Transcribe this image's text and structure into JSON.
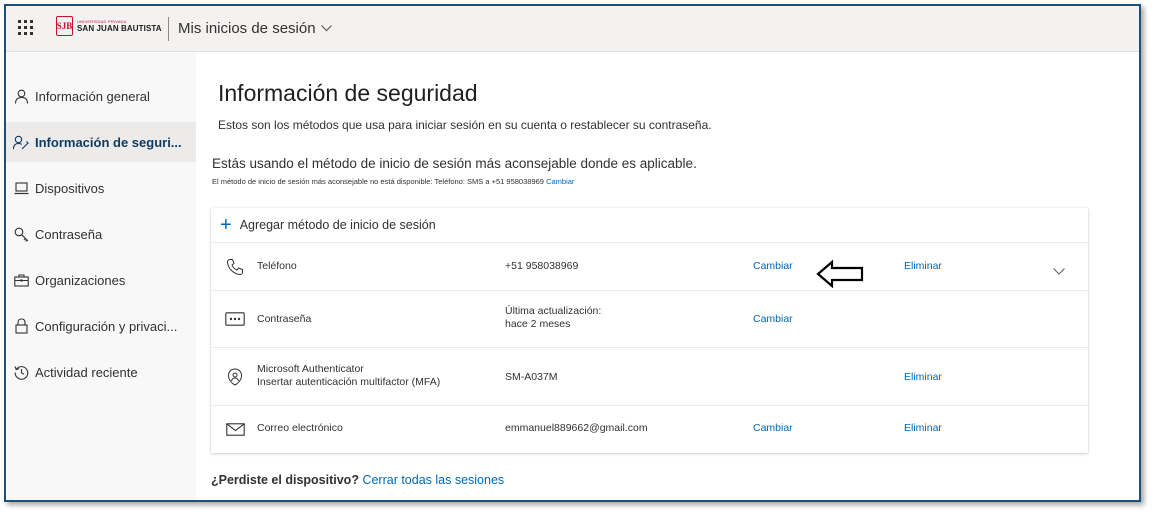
{
  "header": {
    "logo_small": "UNIVERSIDAD PRIVADA",
    "logo_name": "SAN JUAN BAUTISTA",
    "logo_initials": "SJB",
    "title": "Mis inicios de sesión",
    "icons": [
      "waffle-icon",
      "chevron-down-icon"
    ]
  },
  "sidebar": {
    "items": [
      {
        "label": "Información general",
        "icon": "person-icon"
      },
      {
        "label": "Información de seguri...",
        "icon": "security-info-icon"
      },
      {
        "label": "Dispositivos",
        "icon": "laptop-icon"
      },
      {
        "label": "Contraseña",
        "icon": "key-icon"
      },
      {
        "label": "Organizaciones",
        "icon": "briefcase-icon"
      },
      {
        "label": "Configuración y privaci...",
        "icon": "lock-icon"
      },
      {
        "label": "Actividad reciente",
        "icon": "history-icon"
      }
    ],
    "active_index": 1
  },
  "main": {
    "title": "Información de seguridad",
    "subtitle": "Estos son los métodos que usa para iniciar sesión en su cuenta o restablecer su contraseña.",
    "advice": "Estás usando el método de inicio de sesión más aconsejable donde es aplicable.",
    "advice_small": "El método de inicio de sesión más aconsejable no está disponible: Teléfono: SMS a +51 958038969",
    "advice_link": "Cambiar",
    "add_method": "Agregar método de inicio de sesión",
    "methods": [
      {
        "name": "Teléfono",
        "detail": "+51 958038969",
        "change": "Cambiar",
        "delete": "Eliminar",
        "icon": "phone-icon"
      },
      {
        "name": "Contraseña",
        "detail_line1": "Última actualización:",
        "detail_line2": "hace 2 meses",
        "change": "Cambiar",
        "icon": "password-icon"
      },
      {
        "name_line1": "Microsoft Authenticator",
        "name_line2": "Insertar autenticación multifactor (MFA)",
        "detail": "SM-A037M",
        "delete": "Eliminar",
        "icon": "authenticator-icon"
      },
      {
        "name": "Correo electrónico",
        "detail": "emmanuel889662@gmail.com",
        "change": "Cambiar",
        "delete": "Eliminar",
        "icon": "mail-icon"
      }
    ],
    "lost_question": "¿Perdiste el dispositivo?",
    "lost_link": "Cerrar todas las sesiones"
  },
  "colors": {
    "link": "#0067b8",
    "frame_border": "#1f4e79",
    "logo_red": "#c8102e",
    "active_nav": "#edebe9"
  }
}
